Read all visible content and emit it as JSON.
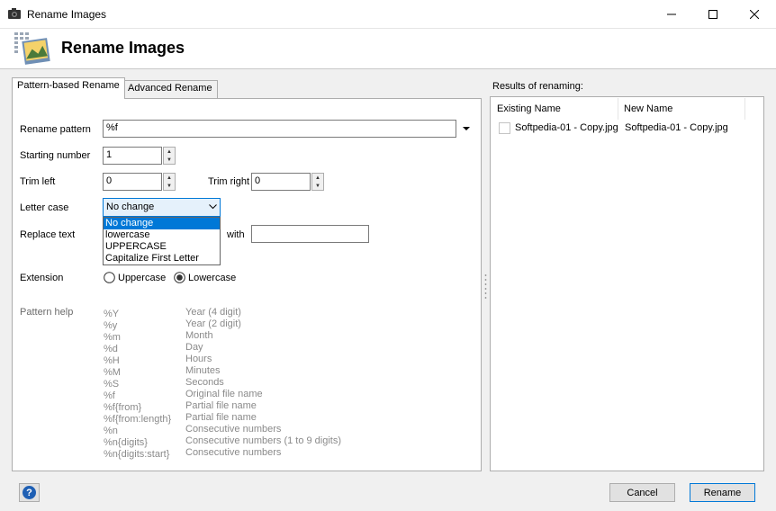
{
  "window": {
    "title": "Rename Images"
  },
  "header": {
    "title": "Rename Images"
  },
  "tabs": [
    {
      "label": "Pattern-based Rename",
      "active": true
    },
    {
      "label": "Advanced Rename",
      "active": false
    }
  ],
  "form": {
    "rename_pattern": {
      "label": "Rename pattern",
      "value": "%f"
    },
    "starting_number": {
      "label": "Starting number",
      "value": "1"
    },
    "trim_left": {
      "label": "Trim left",
      "value": "0"
    },
    "trim_right": {
      "label": "Trim right",
      "value": "0"
    },
    "letter_case": {
      "label": "Letter case",
      "value": "No change",
      "options": [
        "No change",
        "lowercase",
        "UPPERCASE",
        "Capitalize First Letter"
      ]
    },
    "replace_text": {
      "label": "Replace text",
      "with_label": "with",
      "value": ""
    },
    "extension": {
      "label": "Extension",
      "options": [
        {
          "label": "Uppercase",
          "selected": false
        },
        {
          "label": "Lowercase",
          "selected": true
        }
      ]
    }
  },
  "pattern_help": {
    "label": "Pattern help",
    "rows": [
      {
        "key": "%Y",
        "desc": "Year (4 digit)"
      },
      {
        "key": "%y",
        "desc": "Year (2 digit)"
      },
      {
        "key": "%m",
        "desc": "Month"
      },
      {
        "key": "%d",
        "desc": "Day"
      },
      {
        "key": "%H",
        "desc": "Hours"
      },
      {
        "key": "%M",
        "desc": "Minutes"
      },
      {
        "key": "%S",
        "desc": "Seconds"
      },
      {
        "key": "%f",
        "desc": "Original file name"
      },
      {
        "key": "%f{from}",
        "desc": "Partial file name"
      },
      {
        "key": "%f{from:length}",
        "desc": "Partial file name"
      },
      {
        "key": "%n",
        "desc": "Consecutive numbers"
      },
      {
        "key": "%n{digits}",
        "desc": "Consecutive numbers (1 to 9 digits)"
      },
      {
        "key": "%n{digits:start}",
        "desc": "Consecutive numbers"
      }
    ]
  },
  "results": {
    "label": "Results of renaming:",
    "columns": [
      "Existing Name",
      "New Name"
    ],
    "rows": [
      {
        "existing": "Softpedia-01 - Copy.jpg",
        "new": "Softpedia-01 - Copy.jpg"
      }
    ]
  },
  "footer": {
    "cancel_label": "Cancel",
    "rename_label": "Rename",
    "help_glyph": "?"
  },
  "colors": {
    "accent": "#0078d7",
    "help_button": "#1e5fb4"
  }
}
